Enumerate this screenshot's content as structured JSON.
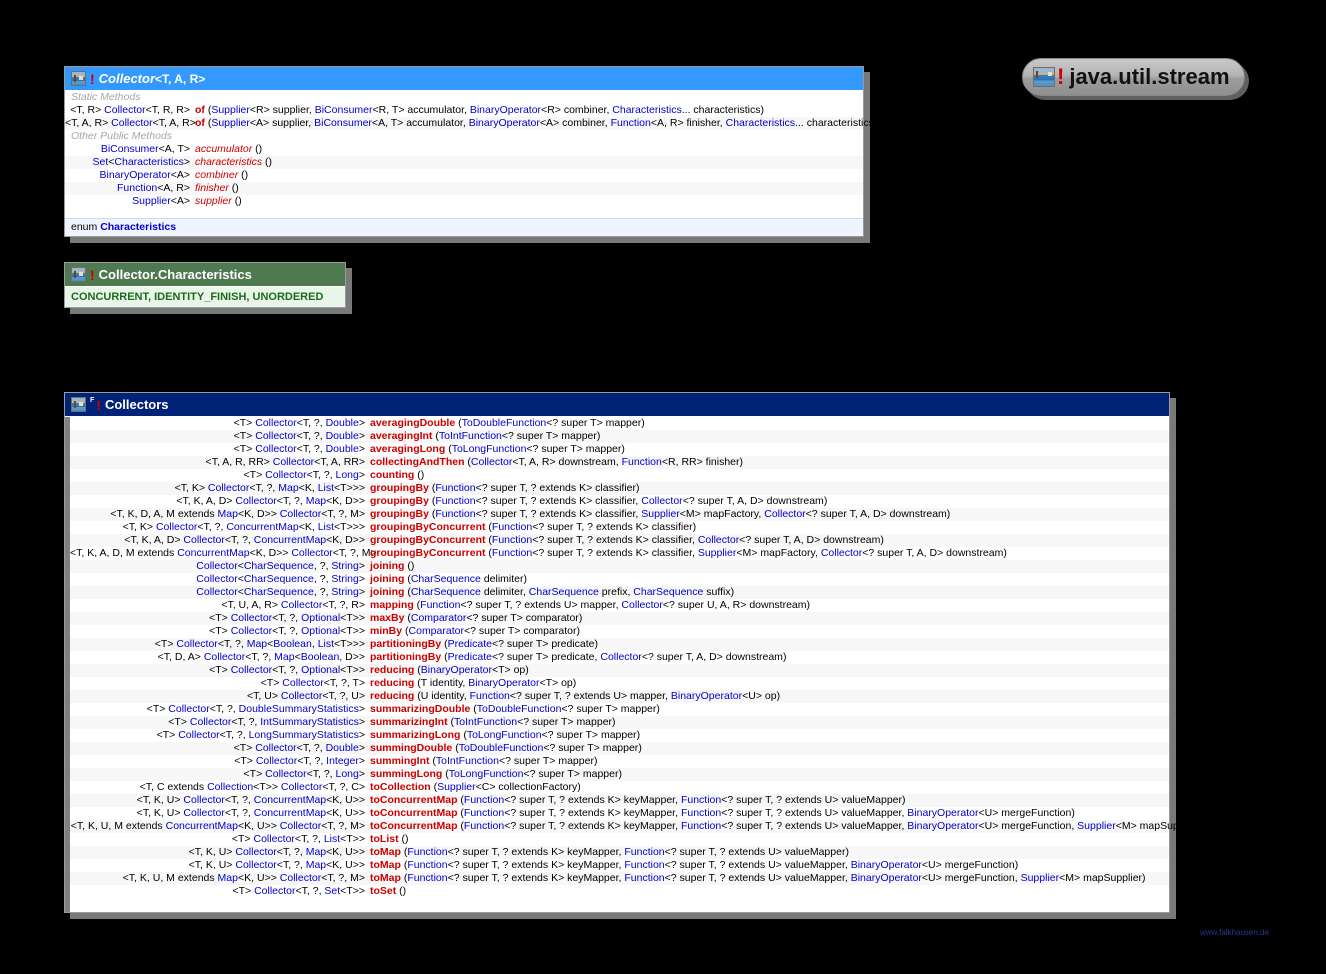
{
  "package_badge": {
    "label": "java.util.stream",
    "icon": "package-icon",
    "marker": "!"
  },
  "watermark": "www.falkhausen.de",
  "colors": {
    "collector_header": "#3399ff",
    "collectors_header": "#002277",
    "enum_header": "#4f7a4f",
    "type_link": "#0000cc",
    "method_name": "#cc0000",
    "enum_text": "#1c6b1c"
  },
  "collector_box": {
    "title": "Collector",
    "generics": "<T, A, R>",
    "marker": "!",
    "sections": [
      {
        "label": "Static Methods",
        "rows": [
          {
            "lhs": "<T, R> Collector<T, R, R>",
            "method": "of",
            "method_style": "bold",
            "params": "(Supplier<R> supplier, BiConsumer<R, T> accumulator, BinaryOperator<R> combiner, Characteristics... characteristics)"
          },
          {
            "lhs": "<T, A, R> Collector<T, A, R>",
            "method": "of",
            "method_style": "bold",
            "params": "(Supplier<A> supplier, BiConsumer<A, T> accumulator, BinaryOperator<A> combiner, Function<A, R> finisher, Characteristics... characteristics)"
          }
        ]
      },
      {
        "label": "Other Public Methods",
        "rows": [
          {
            "lhs": "BiConsumer<A, T>",
            "method": "accumulator",
            "method_style": "italic",
            "params": "()"
          },
          {
            "lhs": "Set<Characteristics>",
            "method": "characteristics",
            "method_style": "italic",
            "params": "()"
          },
          {
            "lhs": "BinaryOperator<A>",
            "method": "combiner",
            "method_style": "italic",
            "params": "()"
          },
          {
            "lhs": "Function<A, R>",
            "method": "finisher",
            "method_style": "italic",
            "params": "()"
          },
          {
            "lhs": "Supplier<A>",
            "method": "supplier",
            "method_style": "italic",
            "params": "()"
          }
        ]
      }
    ],
    "nested": {
      "keyword": "enum",
      "name": "Characteristics"
    }
  },
  "enum_box": {
    "title": "Collector.Characteristics",
    "marker": "!",
    "constants": "CONCURRENT, IDENTITY_FINISH, UNORDERED"
  },
  "collectors_box": {
    "title": "Collectors",
    "marker": "!",
    "superscript": "F",
    "rows": [
      {
        "lhs": "<T> Collector<T, ?, Double>",
        "method": "averagingDouble",
        "params": "(ToDoubleFunction<? super T> mapper)"
      },
      {
        "lhs": "<T> Collector<T, ?, Double>",
        "method": "averagingInt",
        "params": "(ToIntFunction<? super T> mapper)"
      },
      {
        "lhs": "<T> Collector<T, ?, Double>",
        "method": "averagingLong",
        "params": "(ToLongFunction<? super T> mapper)"
      },
      {
        "lhs": "<T, A, R, RR> Collector<T, A, RR>",
        "method": "collectingAndThen",
        "params": "(Collector<T, A, R> downstream, Function<R, RR> finisher)"
      },
      {
        "lhs": "<T> Collector<T, ?, Long>",
        "method": "counting",
        "params": "()"
      },
      {
        "lhs": "<T, K> Collector<T, ?, Map<K, List<T>>>",
        "method": "groupingBy",
        "params": "(Function<? super T, ? extends K> classifier)"
      },
      {
        "lhs": "<T, K, A, D> Collector<T, ?, Map<K, D>>",
        "method": "groupingBy",
        "params": "(Function<? super T, ? extends K> classifier, Collector<? super T, A, D> downstream)"
      },
      {
        "lhs": "<T, K, D, A, M extends Map<K, D>> Collector<T, ?, M>",
        "method": "groupingBy",
        "params": "(Function<? super T, ? extends K> classifier, Supplier<M> mapFactory, Collector<? super T, A, D> downstream)"
      },
      {
        "lhs": "<T, K> Collector<T, ?, ConcurrentMap<K, List<T>>>",
        "method": "groupingByConcurrent",
        "params": "(Function<? super T, ? extends K> classifier)"
      },
      {
        "lhs": "<T, K, A, D> Collector<T, ?, ConcurrentMap<K, D>>",
        "method": "groupingByConcurrent",
        "params": "(Function<? super T, ? extends K> classifier, Collector<? super T, A, D> downstream)"
      },
      {
        "lhs": "<T, K, A, D, M extends ConcurrentMap<K, D>> Collector<T, ?, M>",
        "method": "groupingByConcurrent",
        "params": "(Function<? super T, ? extends K> classifier, Supplier<M> mapFactory, Collector<? super T, A, D> downstream)"
      },
      {
        "lhs": "Collector<CharSequence, ?, String>",
        "method": "joining",
        "params": "()"
      },
      {
        "lhs": "Collector<CharSequence, ?, String>",
        "method": "joining",
        "params": "(CharSequence delimiter)"
      },
      {
        "lhs": "Collector<CharSequence, ?, String>",
        "method": "joining",
        "params": "(CharSequence delimiter, CharSequence prefix, CharSequence suffix)"
      },
      {
        "lhs": "<T, U, A, R> Collector<T, ?, R>",
        "method": "mapping",
        "params": "(Function<? super T, ? extends U> mapper, Collector<? super U, A, R> downstream)"
      },
      {
        "lhs": "<T> Collector<T, ?, Optional<T>>",
        "method": "maxBy",
        "params": "(Comparator<? super T> comparator)"
      },
      {
        "lhs": "<T> Collector<T, ?, Optional<T>>",
        "method": "minBy",
        "params": "(Comparator<? super T> comparator)"
      },
      {
        "lhs": "<T> Collector<T, ?, Map<Boolean, List<T>>>",
        "method": "partitioningBy",
        "params": "(Predicate<? super T> predicate)"
      },
      {
        "lhs": "<T, D, A> Collector<T, ?, Map<Boolean, D>>",
        "method": "partitioningBy",
        "params": "(Predicate<? super T> predicate, Collector<? super T, A, D> downstream)"
      },
      {
        "lhs": "<T> Collector<T, ?, Optional<T>>",
        "method": "reducing",
        "params": "(BinaryOperator<T> op)"
      },
      {
        "lhs": "<T> Collector<T, ?, T>",
        "method": "reducing",
        "params": "(T identity, BinaryOperator<T> op)"
      },
      {
        "lhs": "<T, U> Collector<T, ?, U>",
        "method": "reducing",
        "params": "(U identity, Function<? super T, ? extends U> mapper, BinaryOperator<U> op)"
      },
      {
        "lhs": "<T> Collector<T, ?, DoubleSummaryStatistics>",
        "method": "summarizingDouble",
        "params": "(ToDoubleFunction<? super T> mapper)"
      },
      {
        "lhs": "<T> Collector<T, ?, IntSummaryStatistics>",
        "method": "summarizingInt",
        "params": "(ToIntFunction<? super T> mapper)"
      },
      {
        "lhs": "<T> Collector<T, ?, LongSummaryStatistics>",
        "method": "summarizingLong",
        "params": "(ToLongFunction<? super T> mapper)"
      },
      {
        "lhs": "<T> Collector<T, ?, Double>",
        "method": "summingDouble",
        "params": "(ToDoubleFunction<? super T> mapper)"
      },
      {
        "lhs": "<T> Collector<T, ?, Integer>",
        "method": "summingInt",
        "params": "(ToIntFunction<? super T> mapper)"
      },
      {
        "lhs": "<T> Collector<T, ?, Long>",
        "method": "summingLong",
        "params": "(ToLongFunction<? super T> mapper)"
      },
      {
        "lhs": "<T, C extends Collection<T>> Collector<T, ?, C>",
        "method": "toCollection",
        "params": "(Supplier<C> collectionFactory)"
      },
      {
        "lhs": "<T, K, U> Collector<T, ?, ConcurrentMap<K, U>>",
        "method": "toConcurrentMap",
        "params": "(Function<? super T, ? extends K> keyMapper, Function<? super T, ? extends U> valueMapper)"
      },
      {
        "lhs": "<T, K, U> Collector<T, ?, ConcurrentMap<K, U>>",
        "method": "toConcurrentMap",
        "params": "(Function<? super T, ? extends K> keyMapper, Function<? super T, ? extends U> valueMapper, BinaryOperator<U> mergeFunction)"
      },
      {
        "lhs": "<T, K, U, M extends ConcurrentMap<K, U>> Collector<T, ?, M>",
        "method": "toConcurrentMap",
        "params": "(Function<? super T, ? extends K> keyMapper, Function<? super T, ? extends U> valueMapper, BinaryOperator<U> mergeFunction, Supplier<M> mapSupplier)"
      },
      {
        "lhs": "<T> Collector<T, ?, List<T>>",
        "method": "toList",
        "params": "()"
      },
      {
        "lhs": "<T, K, U> Collector<T, ?, Map<K, U>>",
        "method": "toMap",
        "params": "(Function<? super T, ? extends K> keyMapper, Function<? super T, ? extends U> valueMapper)"
      },
      {
        "lhs": "<T, K, U> Collector<T, ?, Map<K, U>>",
        "method": "toMap",
        "params": "(Function<? super T, ? extends K> keyMapper, Function<? super T, ? extends U> valueMapper, BinaryOperator<U> mergeFunction)"
      },
      {
        "lhs": "<T, K, U, M extends Map<K, U>> Collector<T, ?, M>",
        "method": "toMap",
        "params": "(Function<? super T, ? extends K> keyMapper, Function<? super T, ? extends U> valueMapper, BinaryOperator<U> mergeFunction, Supplier<M> mapSupplier)"
      },
      {
        "lhs": "<T> Collector<T, ?, Set<T>>",
        "method": "toSet",
        "params": "()"
      }
    ]
  }
}
